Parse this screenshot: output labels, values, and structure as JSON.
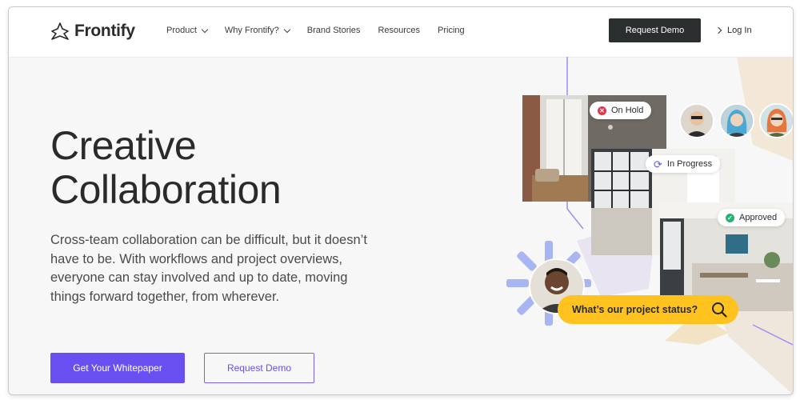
{
  "header": {
    "brand": "Frontify",
    "nav": [
      {
        "label": "Product",
        "has_dropdown": true
      },
      {
        "label": "Why Frontify?",
        "has_dropdown": true
      },
      {
        "label": "Brand Stories",
        "has_dropdown": false
      },
      {
        "label": "Resources",
        "has_dropdown": false
      },
      {
        "label": "Pricing",
        "has_dropdown": false
      }
    ],
    "cta_label": "Request Demo",
    "login_label": "Log In"
  },
  "hero": {
    "title_line1": "Creative",
    "title_line2": "Collaboration",
    "description": "Cross-team collaboration can be difficult, but it doesn’t have to be. With workflows and project overviews, everyone can stay involved and up to date, moving things forward together, from wherever.",
    "primary_button": "Get Your Whitepaper",
    "secondary_button": "Request Demo"
  },
  "visual": {
    "status_pills": [
      {
        "label": "On Hold",
        "icon": "x-circle-icon",
        "color": "#e8334a"
      },
      {
        "label": "In Progress",
        "icon": "refresh-icon",
        "color": "#5a5fd6"
      },
      {
        "label": "Approved",
        "icon": "check-circle-icon",
        "color": "#21b573"
      }
    ],
    "query_text": "What’s our project status?",
    "query_icon": "search-icon"
  },
  "colors": {
    "brand_purple": "#6a4ff0",
    "dark_button": "#2b2e2e",
    "query_yellow": "#ffc21f"
  }
}
